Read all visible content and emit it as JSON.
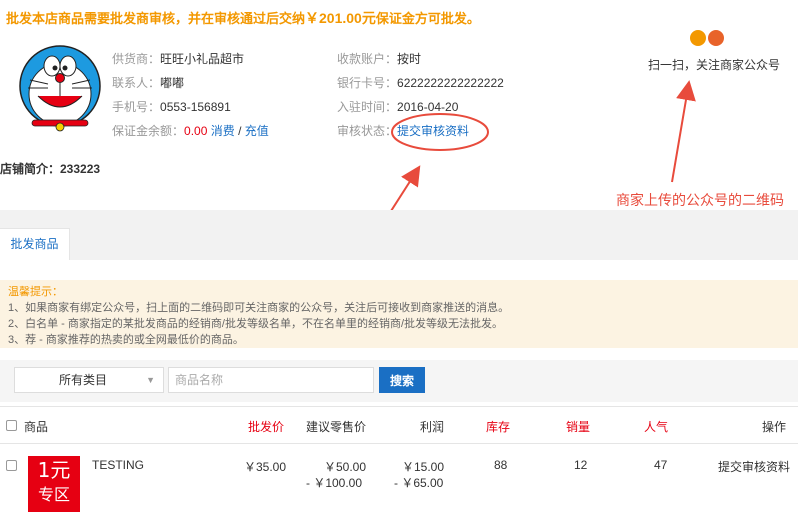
{
  "notice": {
    "prefix": "批发本店商品需要批发商审核，并在审核通过后交纳",
    "amount": "￥201.00元",
    "suffix": "保证金方可批发。"
  },
  "supplier": {
    "name_label": "供货商：",
    "name": "旺旺小礼品超市",
    "contact_label": "联系人：",
    "contact": "嘟嘟",
    "phone_label": "手机号：",
    "phone": "0553-156891",
    "deposit_label": "保证金余额：",
    "deposit": "0.00",
    "consume_link": "消费",
    "separator": "/",
    "recharge_link": "充值"
  },
  "account": {
    "account_label": "收款账户：",
    "account": "按时",
    "card_label": "银行卡号：",
    "card": "6222222222222222",
    "join_label": "入驻时间：",
    "join_date": "2016-04-20",
    "audit_label": "审核状态：",
    "audit_link": "提交审核资料"
  },
  "qr": {
    "text": "扫一扫，关注商家公众号",
    "colors": [
      "#f39800",
      "#e8632a"
    ]
  },
  "shop_intro": "店铺简介：233223",
  "annotation": "商家上传的公众号的二维码",
  "annotation_color": "#e84b3c",
  "tabs": [
    {
      "label": "批发商品"
    }
  ],
  "tips": {
    "title": "温馨提示：",
    "lines": [
      "1、如果商家有绑定公众号，扫上面的二维码即可关注商家的公众号，关注后可接收到商家推送的消息。",
      "2、白名单 - 商家指定的某批发商品的经销商/批发等级名单，不在名单里的经销商/批发等级无法批发。",
      "3、荐 - 商家推荐的热卖的或全网最低价的商品。"
    ]
  },
  "filter": {
    "category": "所有类目",
    "placeholder": "商品名称",
    "search_label": "搜索"
  },
  "table": {
    "headers": {
      "product": "商品",
      "wholesale": "批发价",
      "retail": "建议零售价",
      "profit": "利润",
      "stock": "库存",
      "sales": "销量",
      "popularity": "人气",
      "action": "操作"
    },
    "rows": [
      {
        "thumb_line1": "1元",
        "thumb_line2": "专区",
        "name": "TESTING",
        "wholesale": "￥35.00",
        "retail_min": "￥50.00",
        "retail_max": "- ￥100.00",
        "profit_min": "￥15.00",
        "profit_max": "- ￥65.00",
        "stock": "88",
        "sales": "12",
        "popularity": "47",
        "action": "提交审核资料"
      }
    ]
  },
  "colors": {
    "accent": "#f39800",
    "link": "#1a6fc4",
    "red": "#e60012"
  }
}
